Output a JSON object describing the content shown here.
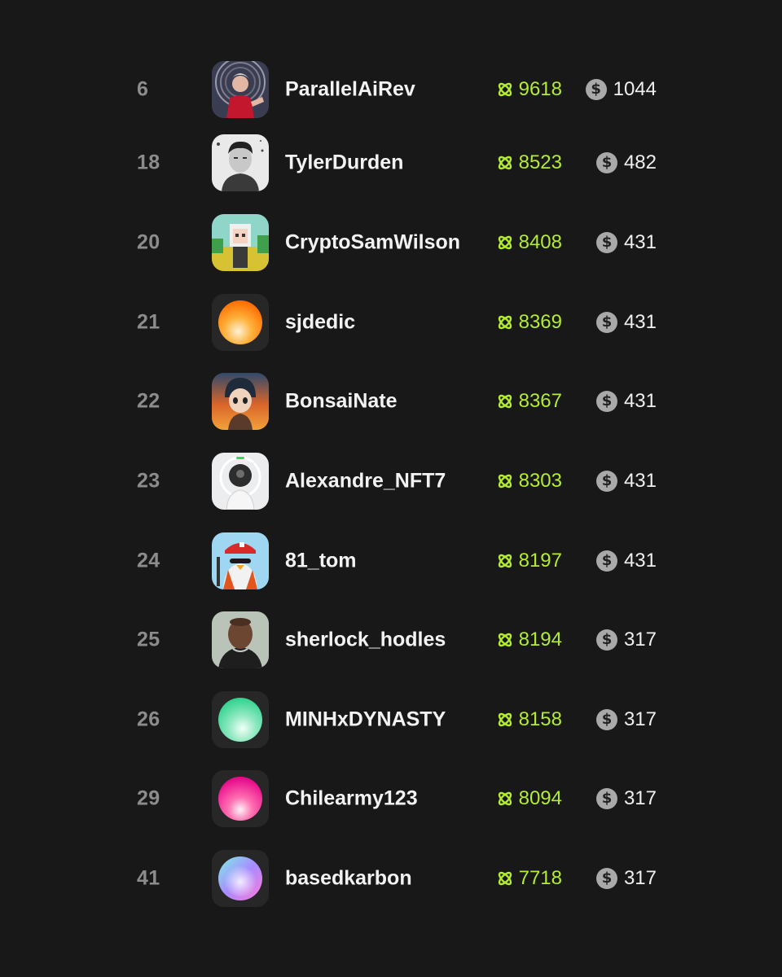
{
  "leaderboard": {
    "points_icon": "atom-icon",
    "coin_icon": "dollar-coin-icon",
    "coin_symbol": "$",
    "accent_color": "#b4ec2e",
    "rows": [
      {
        "rank": "6",
        "username": "ParallelAiRev",
        "points": "9618",
        "coins": "1044",
        "avatar": "portrait-red-jacket"
      },
      {
        "rank": "18",
        "username": "TylerDurden",
        "points": "8523",
        "coins": "482",
        "avatar": "portrait-sketch"
      },
      {
        "rank": "20",
        "username": "CryptoSamWilson",
        "points": "8408",
        "coins": "431",
        "avatar": "pixel-character"
      },
      {
        "rank": "21",
        "username": "sjdedic",
        "points": "8369",
        "coins": "431",
        "avatar": "gradient-orange"
      },
      {
        "rank": "22",
        "username": "BonsaiNate",
        "points": "8367",
        "coins": "431",
        "avatar": "cartoon-character"
      },
      {
        "rank": "23",
        "username": "Alexandre_NFT7",
        "points": "8303",
        "coins": "431",
        "avatar": "astronaut"
      },
      {
        "rank": "24",
        "username": "81_tom",
        "points": "8197",
        "coins": "431",
        "avatar": "penguin"
      },
      {
        "rank": "25",
        "username": "sherlock_hodles",
        "points": "8194",
        "coins": "317",
        "avatar": "portrait-man"
      },
      {
        "rank": "26",
        "username": "MINHxDYNASTY",
        "points": "8158",
        "coins": "317",
        "avatar": "gradient-green"
      },
      {
        "rank": "29",
        "username": "Chilearmy123",
        "points": "8094",
        "coins": "317",
        "avatar": "gradient-pink"
      },
      {
        "rank": "41",
        "username": "basedkarbon",
        "points": "7718",
        "coins": "317",
        "avatar": "gradient-holo"
      }
    ]
  }
}
